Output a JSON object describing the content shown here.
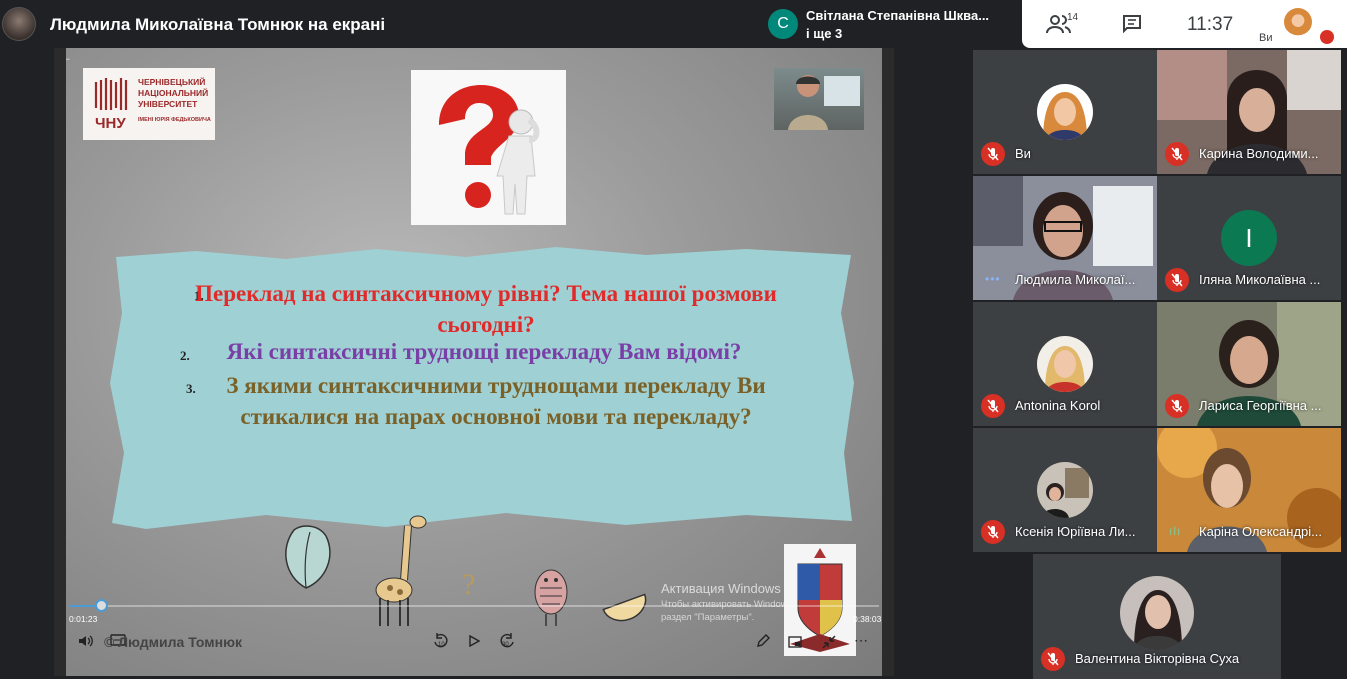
{
  "top_bar": {
    "presenter_title": "Людмила Миколаївна Томнюк на екрані",
    "speaker_chip": {
      "initial": "С",
      "name": "Світлана Степанівна Шква...",
      "more": "і ще 3"
    },
    "people_count": "14",
    "clock": "11:37",
    "self_label": "Ви"
  },
  "slide": {
    "logo": {
      "line1": "ЧЕРНІВЕЦЬКИЙ",
      "line2": "НАЦІОНАЛЬНИЙ",
      "line3": "УНІВЕРСИТЕТ",
      "line4": "ІМЕНІ ЮРІЯ ФЕДЬКОВИЧА"
    },
    "questions": [
      {
        "num": "1.",
        "text": "Переклад на синтаксичному рівні? Тема нашої розмови сьогодні?"
      },
      {
        "num": "2.",
        "text": "Які синтаксичні труднощі перекладу Вам відомі?"
      },
      {
        "num": "3.",
        "text": "З якими синтаксичними труднощами перекладу Ви стикалися на парах основної мови та перекладу?"
      }
    ],
    "watermark_title": "Активация Windows",
    "watermark_text": "Чтобы активировать Windows, перейдите в раздел \"Параметры\".",
    "player": {
      "time_elapsed": "0:01:23",
      "time_total": "0:38:03",
      "progress": 0.04,
      "author": "© Людмила Томнюк",
      "skip_back": "10",
      "skip_forward": "30"
    }
  },
  "participants": [
    {
      "name": "Ви"
    },
    {
      "name": "Карина Володими..."
    },
    {
      "name": "Людмила Миколаї..."
    },
    {
      "name": "Іляна Миколаївна ...",
      "initial": "І"
    },
    {
      "name": "Antonina Korol"
    },
    {
      "name": "Лариса Георгіївна ..."
    },
    {
      "name": "Ксенія Юріївна Ли..."
    },
    {
      "name": "Каріна Олександрі..."
    },
    {
      "name": "Валентина Вікторівна Суха"
    }
  ],
  "colors": {
    "mute_red": "#d93025",
    "meet_bg": "#202124",
    "tile_bg": "#3c4043",
    "accent_blue": "#8ab4f8"
  }
}
